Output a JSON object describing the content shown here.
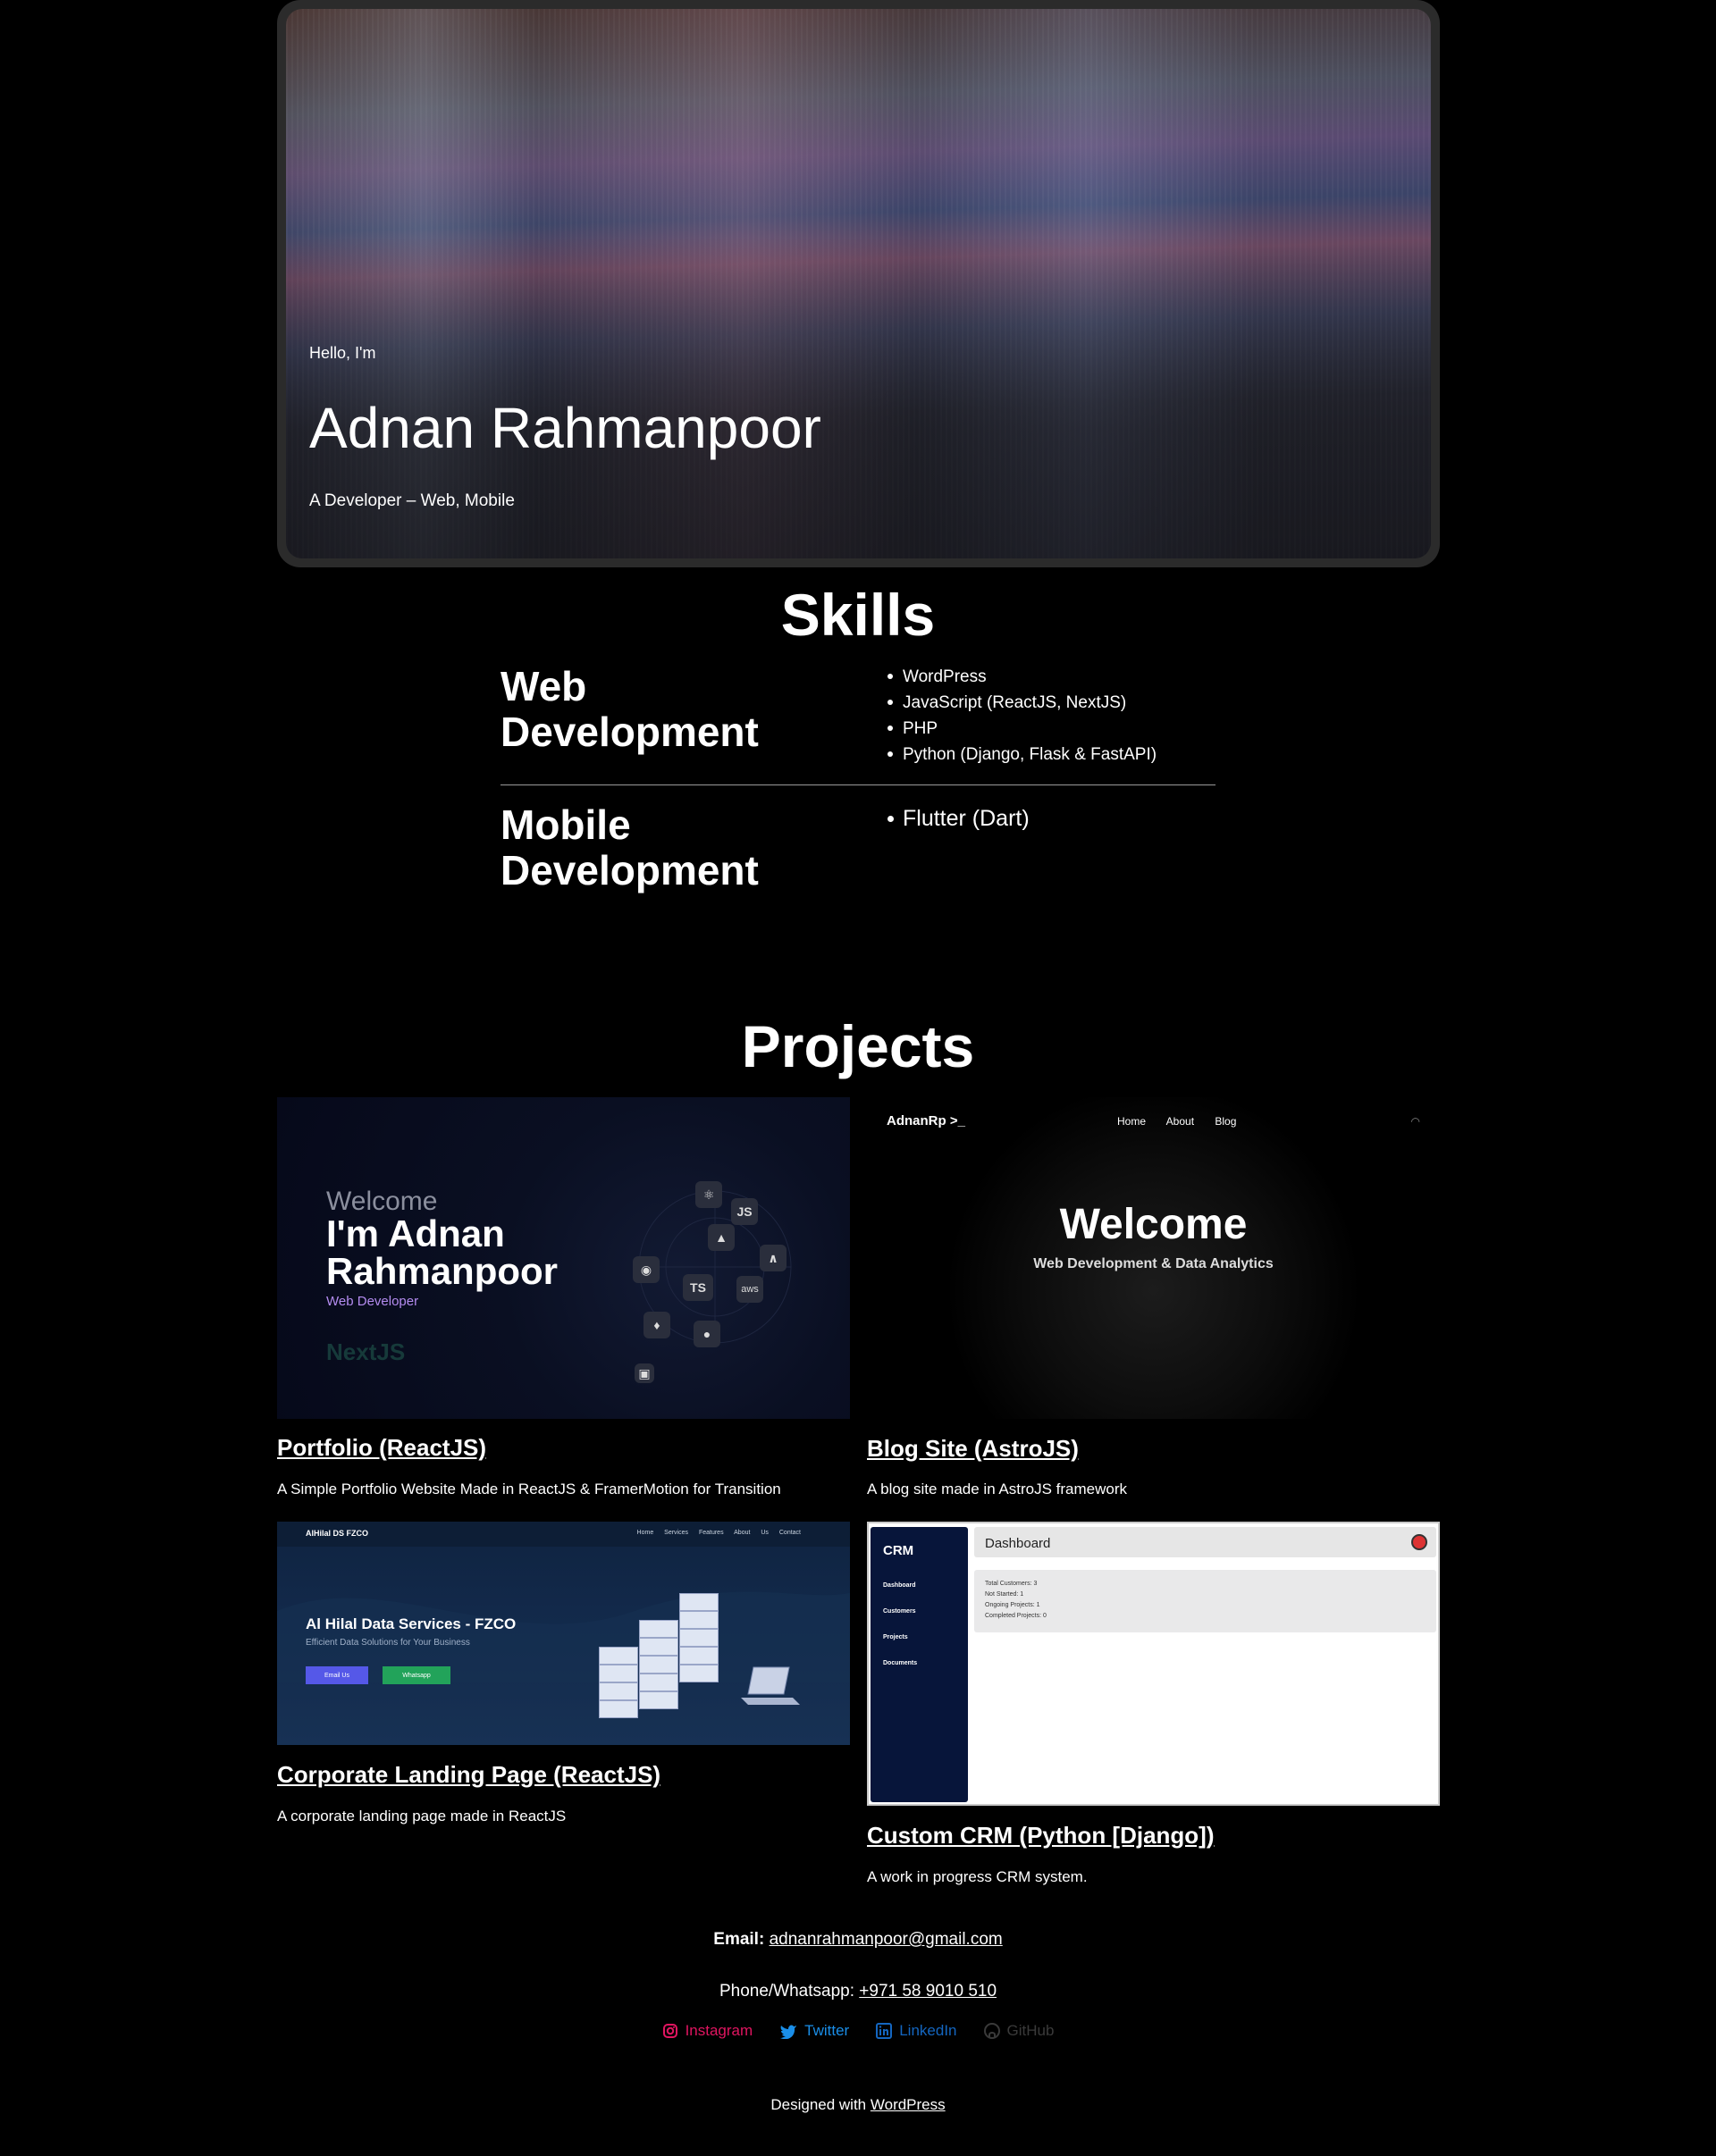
{
  "hero": {
    "greeting": "Hello, I'm",
    "name": "Adnan Rahmanpoor",
    "tagline": "A Developer – Web, Mobile"
  },
  "skills": {
    "title": "Skills",
    "groups": [
      {
        "name_line1": "Web",
        "name_line2": "Development",
        "items": [
          "WordPress",
          "JavaScript (ReactJS, NextJS)",
          "PHP",
          "Python (Django, Flask & FastAPI)"
        ]
      },
      {
        "name_line1": "Mobile",
        "name_line2": "Development",
        "items": [
          "Flutter (Dart)"
        ]
      }
    ]
  },
  "projects": {
    "title": "Projects",
    "items": [
      {
        "title": "Portfolio (ReactJS)",
        "desc": "A Simple Portfolio Website Made in ReactJS & FramerMotion for Transition",
        "shot": {
          "welcome": "Welcome",
          "name_line1": "I'm Adnan",
          "name_line2": "Rahmanpoor",
          "role": "Web Developer",
          "ghost": "NextJS",
          "chips": [
            "JS",
            "TS",
            "aws"
          ]
        }
      },
      {
        "title": "Blog Site (AstroJS)",
        "desc": "A blog site made in AstroJS framework",
        "shot": {
          "logo": "AdnanRp >_",
          "nav": "Home About Blog",
          "welcome": "Welcome",
          "tagline": "Web Development & Data Analytics"
        }
      },
      {
        "title": "Corporate Landing Page (ReactJS)",
        "desc": "A corporate landing page made in ReactJS",
        "shot": {
          "brand": "AlHilal DS FZCO",
          "nav": "Home Services Features About Us Contact",
          "headline": "Al Hilal Data Services - FZCO",
          "sub": "Efficient Data Solutions for Your Business",
          "btn1": "Email Us",
          "btn2": "Whatsapp"
        }
      },
      {
        "title": "Custom CRM (Python [Django])",
        "desc": "A work in progress CRM system.",
        "shot": {
          "brand": "CRM",
          "menu": [
            "Dashboard",
            "Customers",
            "Projects",
            "Documents"
          ],
          "header": "Dashboard",
          "stats": [
            "Total Customers: 3",
            "Not Started: 1",
            "Ongoing Projects: 1",
            "Completed Projects: 0"
          ]
        }
      }
    ]
  },
  "contact": {
    "email_label": "Email:",
    "email": "adnanrahmanpoor@gmail.com",
    "phone_label": "Phone/Whatsapp:",
    "phone": "+971 58 9010 510",
    "social": [
      "Instagram",
      "Twitter",
      "LinkedIn",
      "GitHub"
    ]
  },
  "footer": {
    "text": "Designed with",
    "link": "WordPress"
  },
  "colors": {
    "instagram": "#e01560",
    "twitter": "#1a8ee8",
    "linkedin": "#1466c0",
    "github": "#3a3a3a",
    "background": "#000000"
  }
}
